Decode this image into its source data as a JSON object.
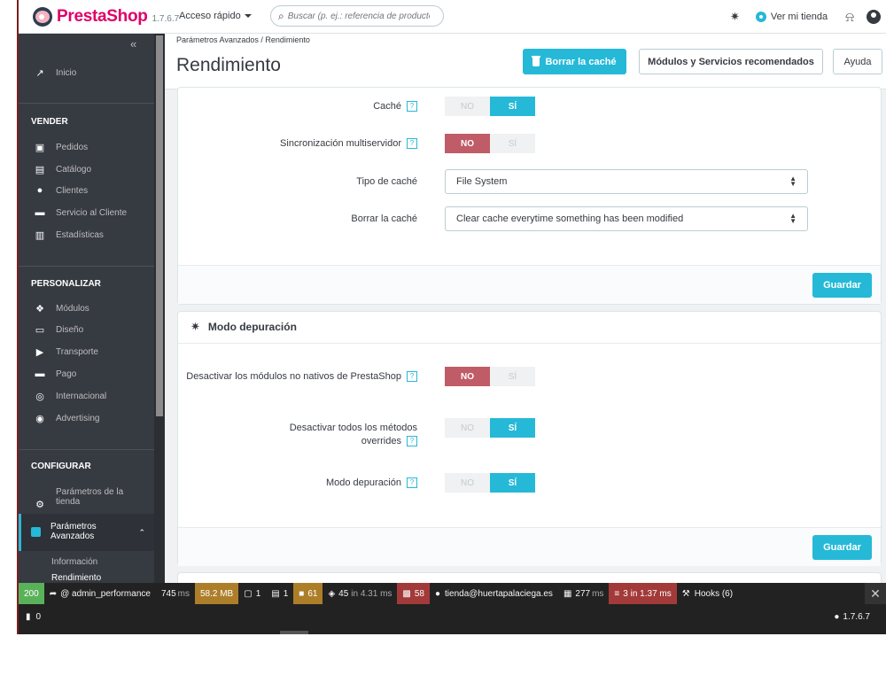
{
  "header": {
    "brand": "PrestaShop",
    "version": "1.7.6.7",
    "quick_access": "Acceso rápido",
    "search_placeholder": "Buscar (p. ej.: referencia de producto, no",
    "view_store": "Ver mi tienda"
  },
  "sidebar": {
    "home": "Inicio",
    "sections": [
      {
        "title": "VENDER",
        "items": [
          "Pedidos",
          "Catálogo",
          "Clientes",
          "Servicio al Cliente",
          "Estadísticas"
        ]
      },
      {
        "title": "PERSONALIZAR",
        "items": [
          "Módulos",
          "Diseño",
          "Transporte",
          "Pago",
          "Internacional",
          "Advertising"
        ]
      },
      {
        "title": "CONFIGURAR",
        "items": [
          "Parámetros de la tienda"
        ]
      }
    ],
    "active": "Parámetros Avanzados",
    "sub_items": [
      "Información",
      "Rendimiento"
    ]
  },
  "page": {
    "breadcrumb": "Parámetros Avanzados  /  Rendimiento",
    "title": "Rendimiento",
    "btn_clear_cache": "Borrar la caché",
    "btn_modules": "Módulos y Servicios recomendados",
    "btn_help": "Ayuda"
  },
  "cache_panel": {
    "rows": [
      {
        "label": "Caché",
        "value": "SÍ"
      },
      {
        "label": "Sincronización multiservidor",
        "value": "NO"
      }
    ],
    "type_label": "Tipo de caché",
    "type_value": "File System",
    "clear_label": "Borrar la caché",
    "clear_value": "Clear cache everytime something has been modified",
    "save": "Guardar"
  },
  "debug_panel": {
    "title": "Modo depuración",
    "rows": [
      {
        "label": "Desactivar los módulos no nativos de PrestaShop",
        "value": "NO"
      },
      {
        "label": "Desactivar todos los métodos overrides",
        "value": "SÍ"
      },
      {
        "label": "Modo depuración",
        "value": "SÍ"
      }
    ],
    "save": "Guardar"
  },
  "switch_labels": {
    "no": "NO",
    "yes": "SÍ"
  },
  "toolbar": {
    "status": "200",
    "route": "@ admin_performance",
    "time": "745",
    "time_unit": "ms",
    "memory": "58.2 MB",
    "c1": "1",
    "c2": "1",
    "c3": "61",
    "queries": "45",
    "queries_time": "in 4.31 ms",
    "translations": "58",
    "user": "tienda@huertapalaciega.es",
    "render": "277",
    "render_unit": "ms",
    "cache": "3 in 1.37 ms",
    "hooks": "Hooks (6)",
    "row2_count": "0",
    "version": "1.7.6.7"
  },
  "colors": {
    "accent": "#25b9d7",
    "brand": "#df0067",
    "danger": "#c05c67",
    "sidebar": "#363a41"
  }
}
